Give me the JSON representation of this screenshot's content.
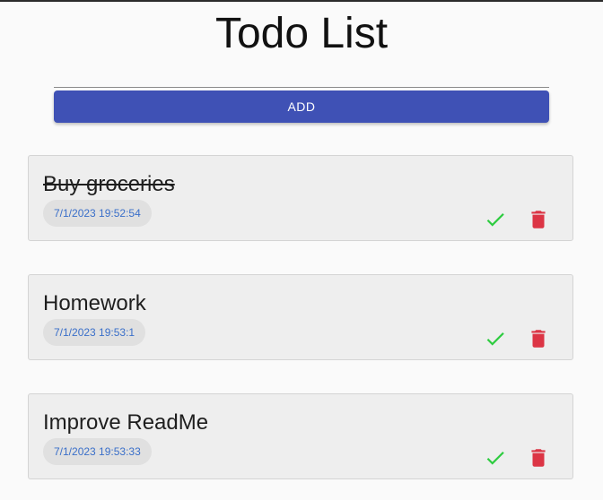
{
  "header": {
    "title": "Todo List"
  },
  "form": {
    "input_value": "",
    "input_placeholder": "",
    "add_label": "ADD"
  },
  "todos": [
    {
      "text": "Buy groceries",
      "timestamp": "7/1/2023 19:52:54",
      "completed": true
    },
    {
      "text": "Homework",
      "timestamp": "7/1/2023 19:53:1",
      "completed": false
    },
    {
      "text": "Improve ReadMe",
      "timestamp": "7/1/2023 19:53:33",
      "completed": false
    }
  ],
  "icons": {
    "check": "check-icon",
    "delete": "trash-icon"
  },
  "colors": {
    "accent": "#3f51b5",
    "check": "#2ecc40",
    "delete": "#dc3545",
    "timestamp": "#3a6fc9",
    "card_bg": "#eeeeee"
  }
}
